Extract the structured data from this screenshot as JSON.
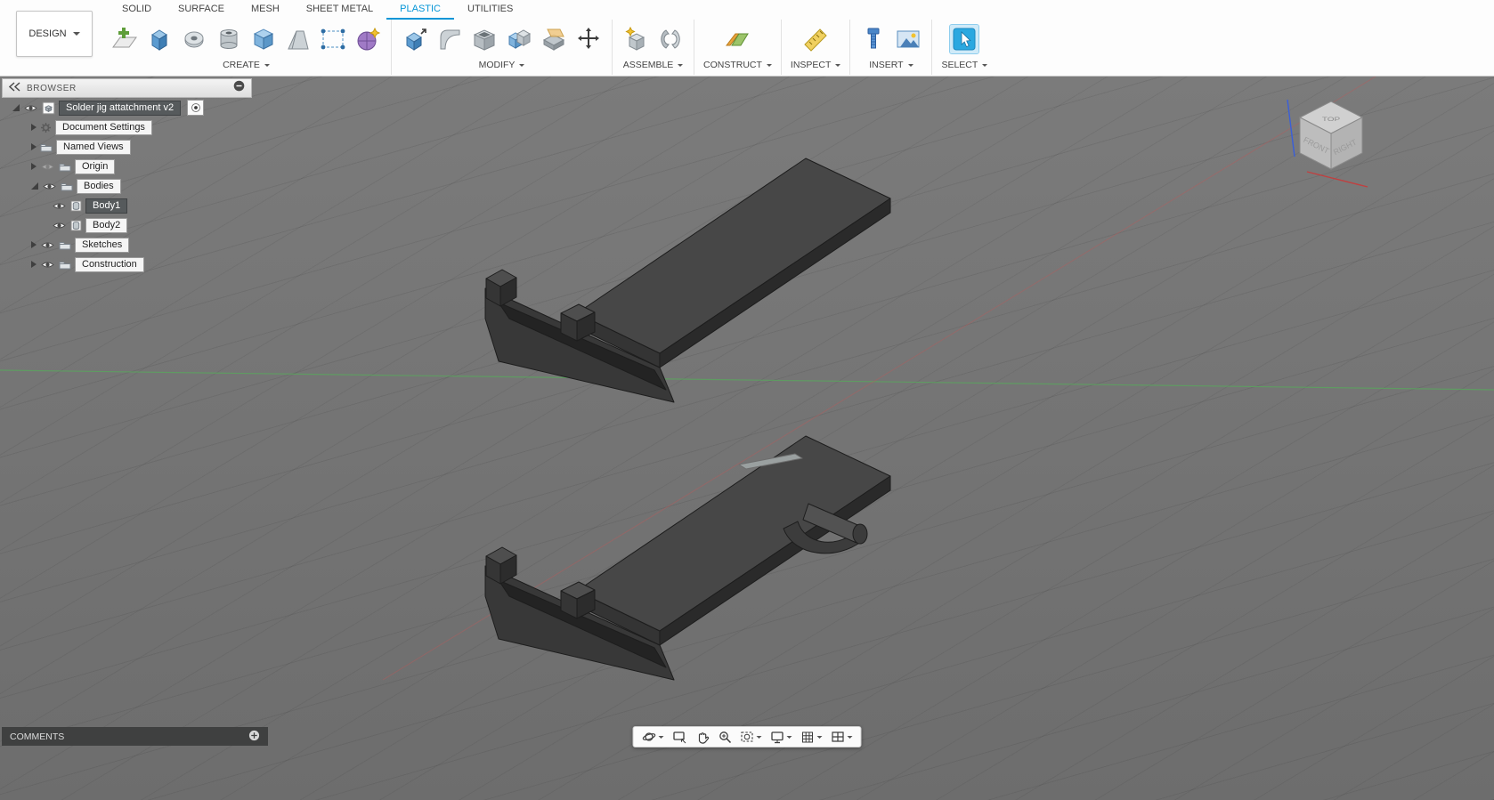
{
  "header": {
    "design_label": "DESIGN",
    "tabs": [
      "SOLID",
      "SURFACE",
      "MESH",
      "SHEET METAL",
      "PLASTIC",
      "UTILITIES"
    ],
    "active_tab": "PLASTIC",
    "groups": [
      {
        "label": "CREATE",
        "icons": [
          "create-sketch",
          "extrude",
          "revolve",
          "hole",
          "box",
          "draft",
          "rectangular-pattern",
          "lattice"
        ]
      },
      {
        "label": "MODIFY",
        "icons": [
          "press-pull",
          "fillet",
          "shell",
          "combine",
          "split-body",
          "move-copy"
        ]
      },
      {
        "label": "ASSEMBLE",
        "icons": [
          "new-component",
          "joint"
        ]
      },
      {
        "label": "CONSTRUCT",
        "icons": [
          "construction-plane"
        ]
      },
      {
        "label": "INSPECT",
        "icons": [
          "measure"
        ]
      },
      {
        "label": "INSERT",
        "icons": [
          "insert-fastener",
          "canvas"
        ]
      },
      {
        "label": "SELECT",
        "icons": [
          "select"
        ]
      }
    ]
  },
  "browser": {
    "title": "BROWSER",
    "header_icons": [
      "collapse-panel",
      "remove"
    ],
    "tree": [
      {
        "label": "Solder jig attatchment v2",
        "icon": "document",
        "level": 0,
        "expanded": true,
        "visible": true,
        "selected": true,
        "active_component": true
      },
      {
        "label": "Document Settings",
        "icon": "gear",
        "level": 1,
        "expandable": true
      },
      {
        "label": "Named Views",
        "icon": "folder",
        "level": 1,
        "expandable": true
      },
      {
        "label": "Origin",
        "icon": "folder",
        "level": 1,
        "expandable": true,
        "visible": false
      },
      {
        "label": "Bodies",
        "icon": "folder",
        "level": 1,
        "expanded": true,
        "visible": true
      },
      {
        "label": "Body1",
        "icon": "body",
        "level": 2,
        "visible": true,
        "selected": true
      },
      {
        "label": "Body2",
        "icon": "body",
        "level": 2,
        "visible": true
      },
      {
        "label": "Sketches",
        "icon": "folder",
        "level": 1,
        "expandable": true,
        "visible": true
      },
      {
        "label": "Construction",
        "icon": "folder",
        "level": 1,
        "expandable": true,
        "visible": true
      }
    ]
  },
  "viewcube": {
    "top": "TOP",
    "front": "FRONT",
    "right": "RIGHT"
  },
  "comments": {
    "label": "COMMENTS",
    "icons": [
      "add-comment"
    ]
  },
  "nav_toolbar": {
    "icons": [
      "orbit",
      "look-at",
      "pan",
      "zoom",
      "fit",
      "display-settings",
      "grid-settings",
      "viewports"
    ]
  },
  "colors": {
    "accent_blue": "#0696d7",
    "selection_dark": "#565a5c",
    "viewport_background": "#757575",
    "body_top": "#474747",
    "body_front": "#2a2a2a",
    "axis_green": "#58a85c",
    "axis_red": "#b95b5b"
  }
}
